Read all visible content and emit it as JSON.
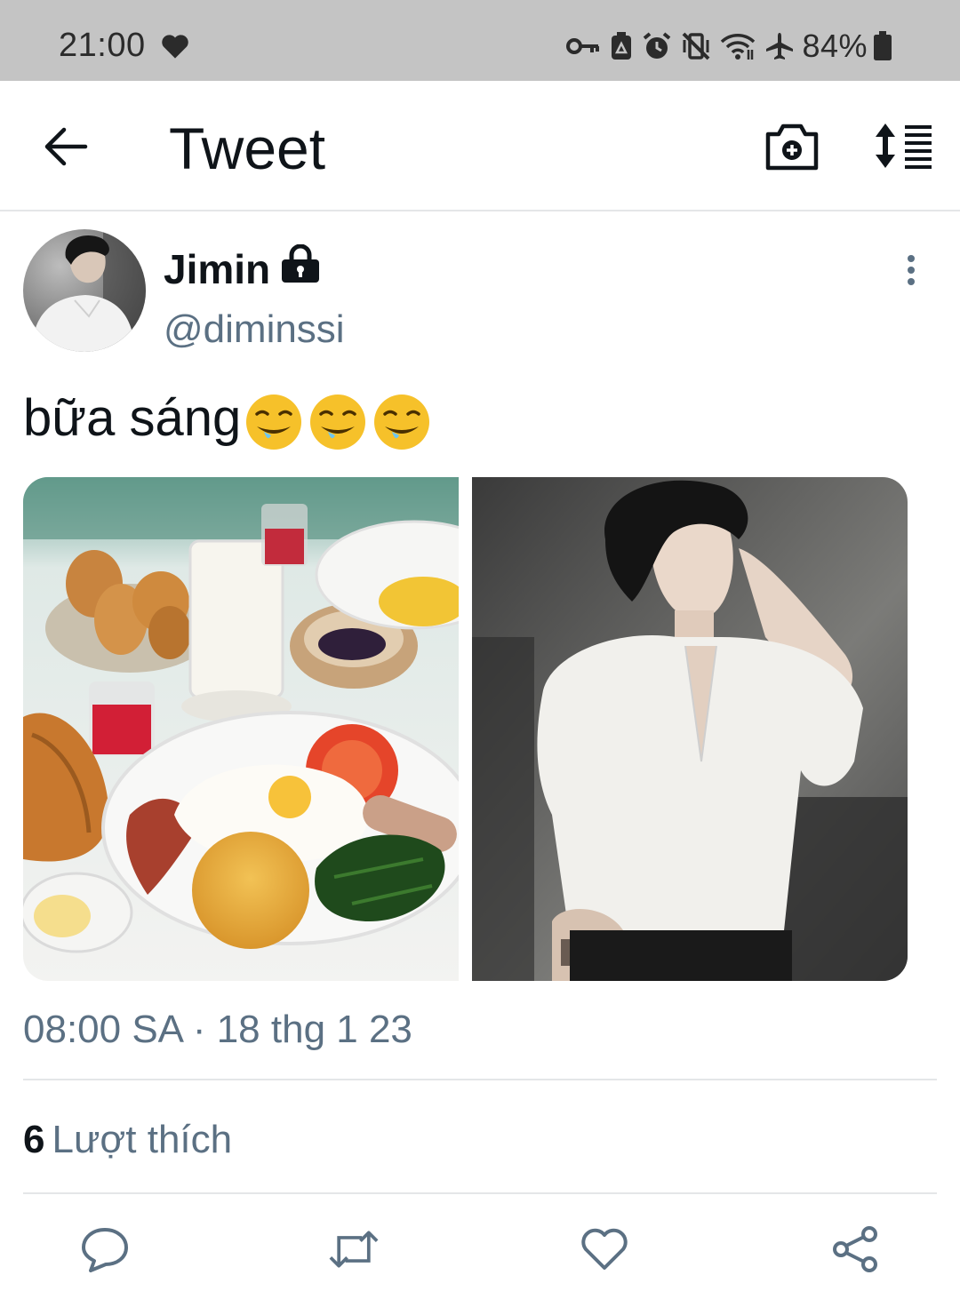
{
  "status_bar": {
    "time": "21:00",
    "battery_percent": "84%",
    "icons": [
      "heart-icon",
      "key-icon",
      "recycle-icon",
      "alarm-icon",
      "mute-vibrate-icon",
      "wifi-icon",
      "airplane-icon",
      "battery-icon"
    ]
  },
  "header": {
    "title": "Tweet",
    "back_icon": "arrow-left-icon",
    "camera_icon": "camera-plus-icon",
    "sort_icon": "sort-list-icon"
  },
  "tweet": {
    "author_name": "Jimin",
    "author_handle": "@diminssi",
    "text": "bữa sáng",
    "emoji": [
      "drooling-face",
      "drooling-face",
      "drooling-face"
    ],
    "timestamp": "08:00 SA · 18 thg 1 23",
    "likes_count": "6",
    "likes_label": "Lượt thích"
  },
  "actions": [
    "reply-icon",
    "retweet-icon",
    "like-icon",
    "share-icon"
  ],
  "colors": {
    "status_bar_bg": "#c4c4c4",
    "text_primary": "#0f1419",
    "text_secondary": "#5b7083",
    "divider": "#e4e6e8"
  }
}
